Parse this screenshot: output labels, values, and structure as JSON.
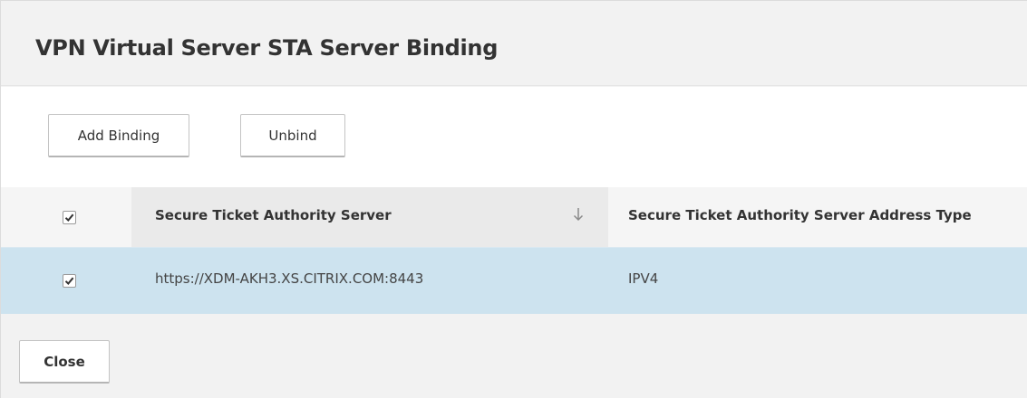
{
  "dialog": {
    "title": "VPN Virtual Server STA Server Binding"
  },
  "toolbar": {
    "add_binding_label": "Add Binding",
    "unbind_label": "Unbind"
  },
  "table": {
    "header_checkbox_checked": true,
    "columns": [
      {
        "label": "Secure Ticket Authority Server",
        "sort_icon": "arrow-down-icon"
      },
      {
        "label": "Secure Ticket Authority Server Address Type"
      }
    ],
    "rows": [
      {
        "checked": true,
        "selected": true,
        "cells": [
          "https://XDM-AKH3.XS.CITRIX.COM:8443",
          "IPV4"
        ]
      }
    ]
  },
  "footer": {
    "close_label": "Close"
  },
  "colors": {
    "page_background": "#f2f2f2",
    "content_background": "#ffffff",
    "selected_row": "#cde3ef",
    "sorted_column_header": "#eaeaea",
    "text": "#333333"
  }
}
